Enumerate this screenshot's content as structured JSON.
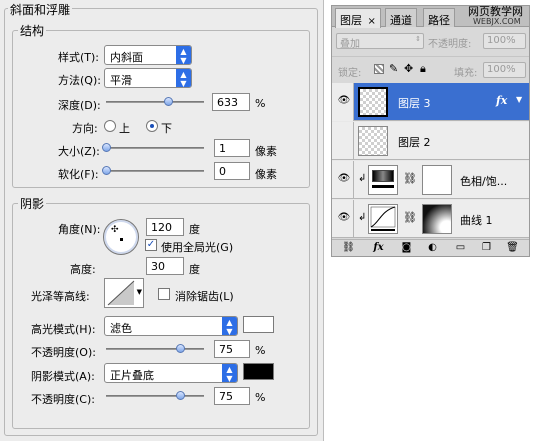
{
  "dialog": {
    "section_title": "斜面和浮雕",
    "structure": {
      "title": "结构",
      "style_label": "样式(T):",
      "style_value": "内斜面",
      "technique_label": "方法(Q):",
      "technique_value": "平滑",
      "depth_label": "深度(D):",
      "depth_value": "633",
      "depth_unit": "%",
      "direction_label": "方向:",
      "direction_up": "上",
      "direction_down": "下",
      "size_label": "大小(Z):",
      "size_value": "1",
      "size_unit": "像素",
      "soften_label": "软化(F):",
      "soften_value": "0",
      "soften_unit": "像素"
    },
    "shading": {
      "title": "阴影",
      "angle_label": "角度(N):",
      "angle_value": "120",
      "angle_unit": "度",
      "global_light_label": "使用全局光(G)",
      "global_light_checked": true,
      "altitude_label": "高度:",
      "altitude_value": "30",
      "altitude_unit": "度",
      "gloss_contour_label": "光泽等高线:",
      "anti_aliased_label": "消除锯齿(L)",
      "anti_aliased_checked": false,
      "highlight_mode_label": "高光模式(H):",
      "highlight_mode_value": "滤色",
      "highlight_color": "#ffffff",
      "highlight_opacity_label": "不透明度(O):",
      "highlight_opacity_value": "75",
      "highlight_opacity_unit": "%",
      "shadow_mode_label": "阴影模式(A):",
      "shadow_mode_value": "正片叠底",
      "shadow_color": "#000000",
      "shadow_opacity_label": "不透明度(C):",
      "shadow_opacity_value": "75",
      "shadow_opacity_unit": "%"
    }
  },
  "layers_panel": {
    "tabs": [
      "图层",
      "通道",
      "路径"
    ],
    "tab_close": "×",
    "watermark_line1": "网页教学网",
    "watermark_line2": "WEBJX.COM",
    "blend_mode": "叠加",
    "opacity_label": "不透明度:",
    "opacity_value": "100%",
    "lock_label": "锁定:",
    "fill_label": "填充:",
    "fill_value": "100%",
    "layers": [
      {
        "name": "图层 3",
        "selected": true,
        "fx": "fx"
      },
      {
        "name": "图层 2",
        "selected": false
      },
      {
        "name": "色相/饱...",
        "selected": false
      },
      {
        "name": "曲线 1",
        "selected": false
      }
    ]
  },
  "colors": {
    "selection_blue": "#3a6fd0",
    "dropdown_blue": "#2d6ee6"
  }
}
